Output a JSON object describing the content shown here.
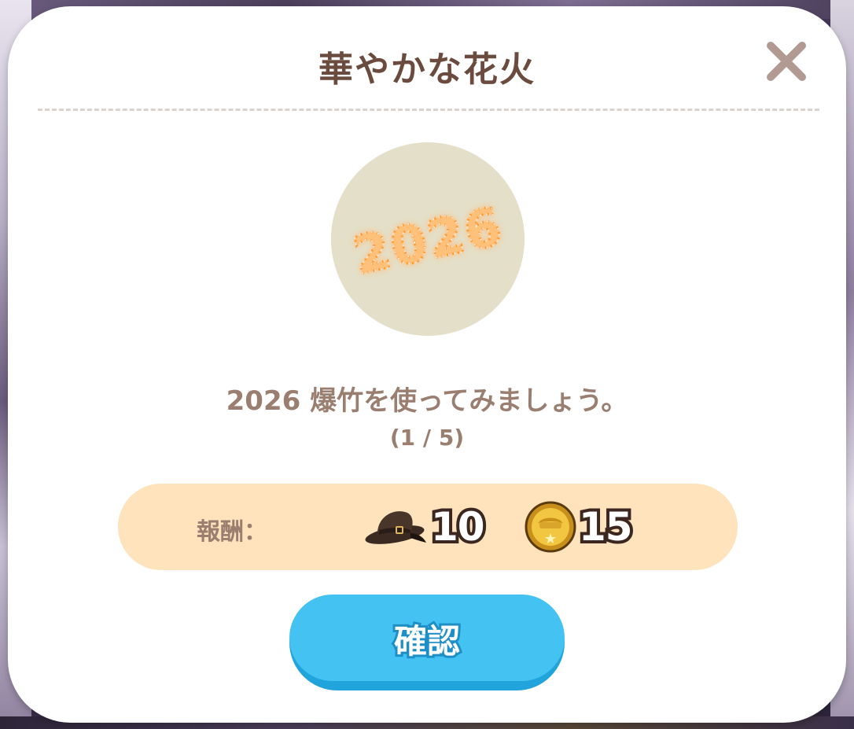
{
  "dialog": {
    "title": "華やかな花火",
    "badge_text": "2026",
    "description": "2026 爆竹を使ってみましょう。",
    "progress": "(1 / 5)",
    "reward_label": "報酬：",
    "rewards": [
      {
        "icon": "hat-icon",
        "count": "10"
      },
      {
        "icon": "coin-icon",
        "count": "15"
      }
    ],
    "confirm_label": "確認"
  },
  "colors": {
    "title": "#6b4b3e",
    "body_text": "#9a7e70",
    "reward_bar": "#fee3bc",
    "badge_bg": "#e4dfc8",
    "confirm_button": "#44c3f2",
    "close_icon": "#b19a92"
  }
}
